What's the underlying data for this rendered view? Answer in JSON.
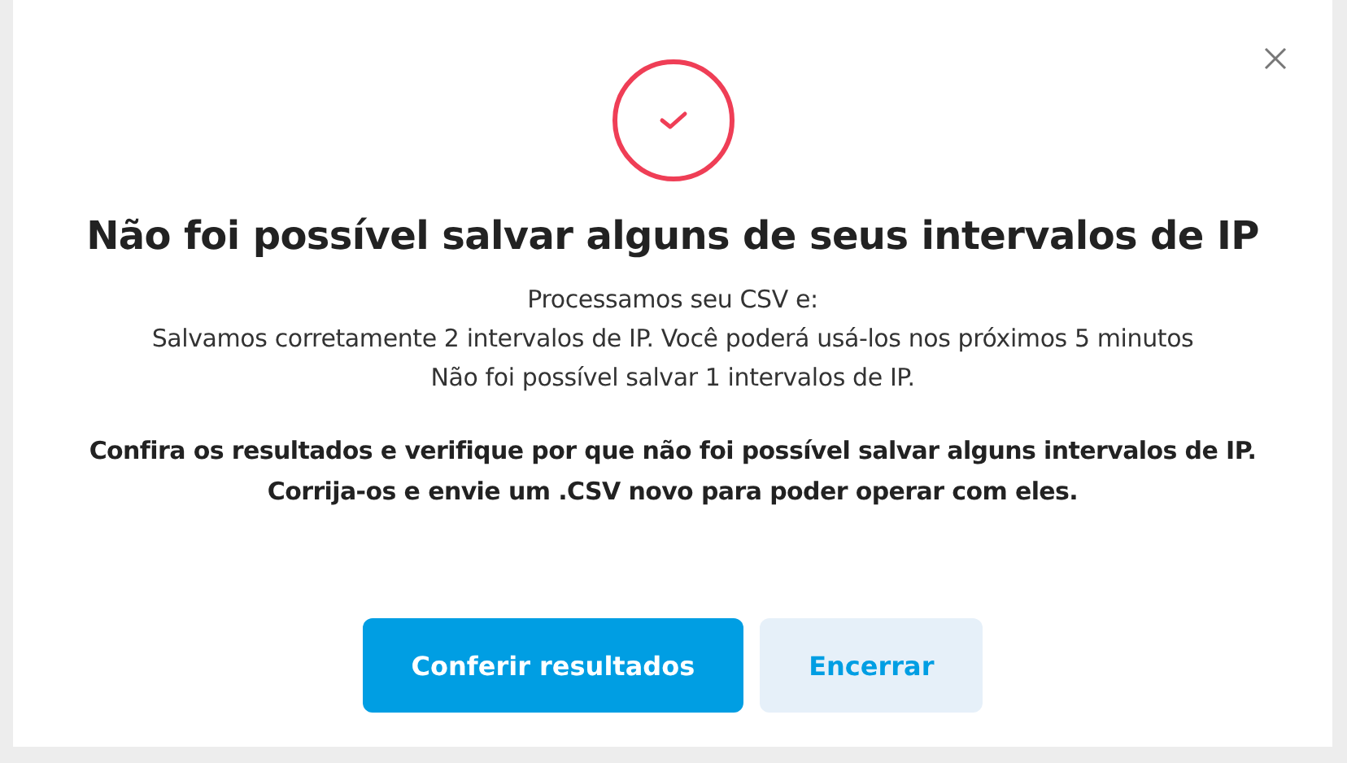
{
  "dialog": {
    "title": "Não foi possível salvar alguns de seus intervalos de IP",
    "lines": [
      "Processamos seu CSV e:",
      "Salvamos corretamente 2 intervalos de IP. Você poderá usá-los nos próximos 5 minutos",
      "Não foi possível salvar 1 intervalos de IP."
    ],
    "notes": [
      "Confira os resultados e verifique por que não foi possível salvar alguns intervalos de IP.",
      "Corrija-os e envie um .CSV novo para poder operar com eles."
    ],
    "buttons": [
      {
        "label": "Conferir resultados",
        "kind": "primary"
      },
      {
        "label": "Encerrar",
        "kind": "secondary"
      }
    ]
  }
}
